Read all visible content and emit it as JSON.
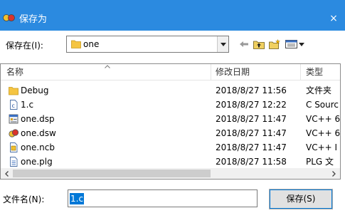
{
  "window": {
    "title": "保存为",
    "close_label": "×"
  },
  "location": {
    "label": "保存在(I):",
    "value": "one"
  },
  "toolbar": {
    "icons": [
      "back-arrow-icon",
      "up-folder-icon",
      "new-folder-icon",
      "view-menu-icon"
    ]
  },
  "columns": {
    "name": "名称",
    "date": "修改日期",
    "type": "类型"
  },
  "files": [
    {
      "name": "Debug",
      "date": "2018/8/27 11:56",
      "type": "文件夹",
      "icon": "folder-icon"
    },
    {
      "name": "1.c",
      "date": "2018/8/27 12:22",
      "type": "C Sourc",
      "icon": "c-source-file-icon"
    },
    {
      "name": "one.dsp",
      "date": "2018/8/27 11:47",
      "type": "VC++ 6",
      "icon": "project-file-icon"
    },
    {
      "name": "one.dsw",
      "date": "2018/8/27 11:47",
      "type": "VC++ 6",
      "icon": "workspace-file-icon"
    },
    {
      "name": "one.ncb",
      "date": "2018/8/27 11:47",
      "type": "VC++ I",
      "icon": "ncb-file-icon"
    },
    {
      "name": "one.plg",
      "date": "2018/8/27 11:58",
      "type": "PLG 文",
      "icon": "plg-file-icon"
    }
  ],
  "filename": {
    "label": "文件名(N):",
    "value": "1.c"
  },
  "buttons": {
    "save": "保存(S)"
  },
  "colors": {
    "titlebar": "#2b8ae0",
    "selection": "#0078d7",
    "folder": "#f5c542"
  }
}
